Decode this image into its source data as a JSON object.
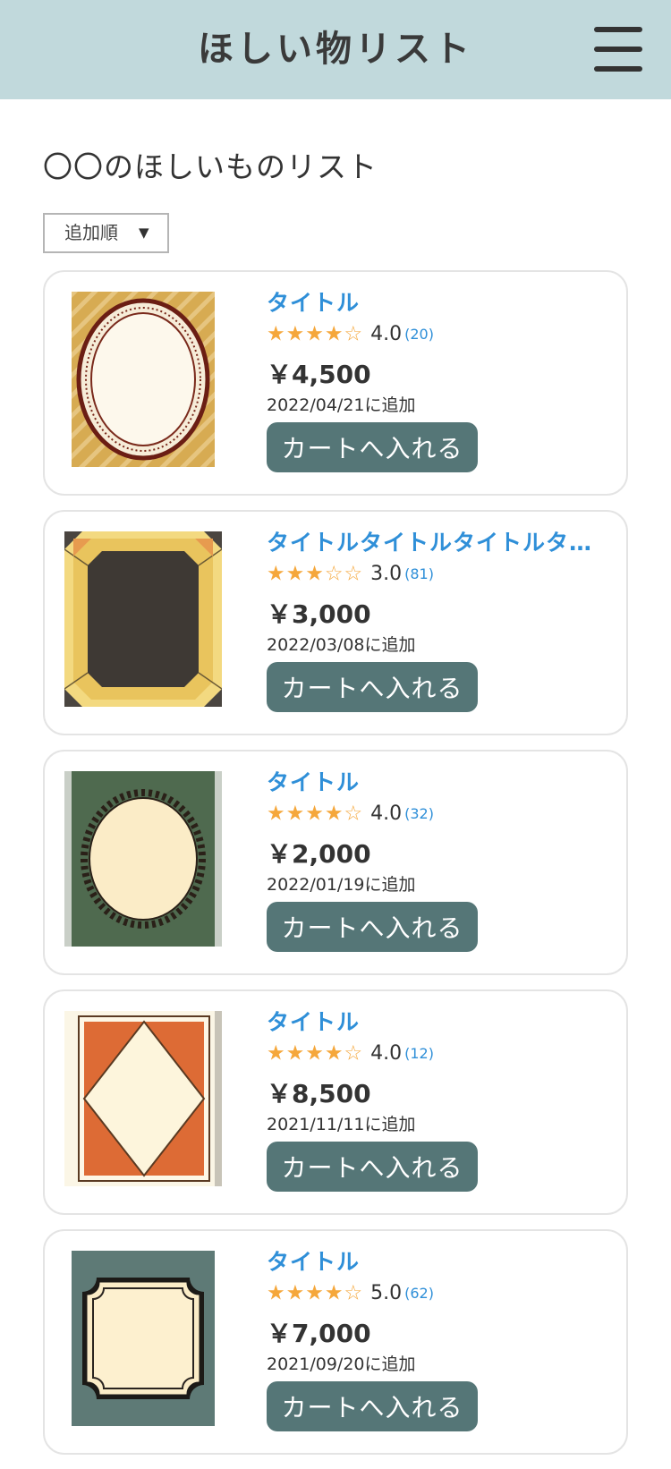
{
  "header": {
    "title": "ほしい物リスト",
    "menu_icon": "hamburger-menu-icon"
  },
  "page_title": "〇〇のほしいものリスト",
  "sort": {
    "selected": "追加順",
    "arrow": "▼"
  },
  "colors": {
    "header_bg": "#c1d9dc",
    "link_blue": "#2f8fd8",
    "star_orange": "#f5a73b",
    "button_teal": "#557677"
  },
  "items": [
    {
      "title": "タイトル",
      "stars": "★★★★☆",
      "rating": "4.0",
      "reviews": "(20)",
      "price": "￥4,500",
      "added": "2022/04/21に追加",
      "button": "カートへ入れる",
      "image": "oval-frame-mustard-stripes"
    },
    {
      "title": "タイトルタイトルタイトルタイト…",
      "stars": "★★★☆☆",
      "rating": "3.0",
      "reviews": "(81)",
      "price": "￥3,000",
      "added": "2022/03/08に追加",
      "button": "カートへ入れる",
      "image": "gold-faceted-frame-dark"
    },
    {
      "title": "タイトル",
      "stars": "★★★★☆",
      "rating": "4.0",
      "reviews": "(32)",
      "price": "￥2,000",
      "added": "2022/01/19に追加",
      "button": "カートへ入れる",
      "image": "ornate-oval-frame-green"
    },
    {
      "title": "タイトル",
      "stars": "★★★★☆",
      "rating": "4.0",
      "reviews": "(12)",
      "price": "￥8,500",
      "added": "2021/11/11に追加",
      "button": "カートへ入れる",
      "image": "diamond-frame-orange"
    },
    {
      "title": "タイトル",
      "stars": "★★★★☆",
      "rating": "5.0",
      "reviews": "(62)",
      "price": "￥7,000",
      "added": "2021/09/20に追加",
      "button": "カートへ入れる",
      "image": "scalloped-frame-sage"
    }
  ]
}
